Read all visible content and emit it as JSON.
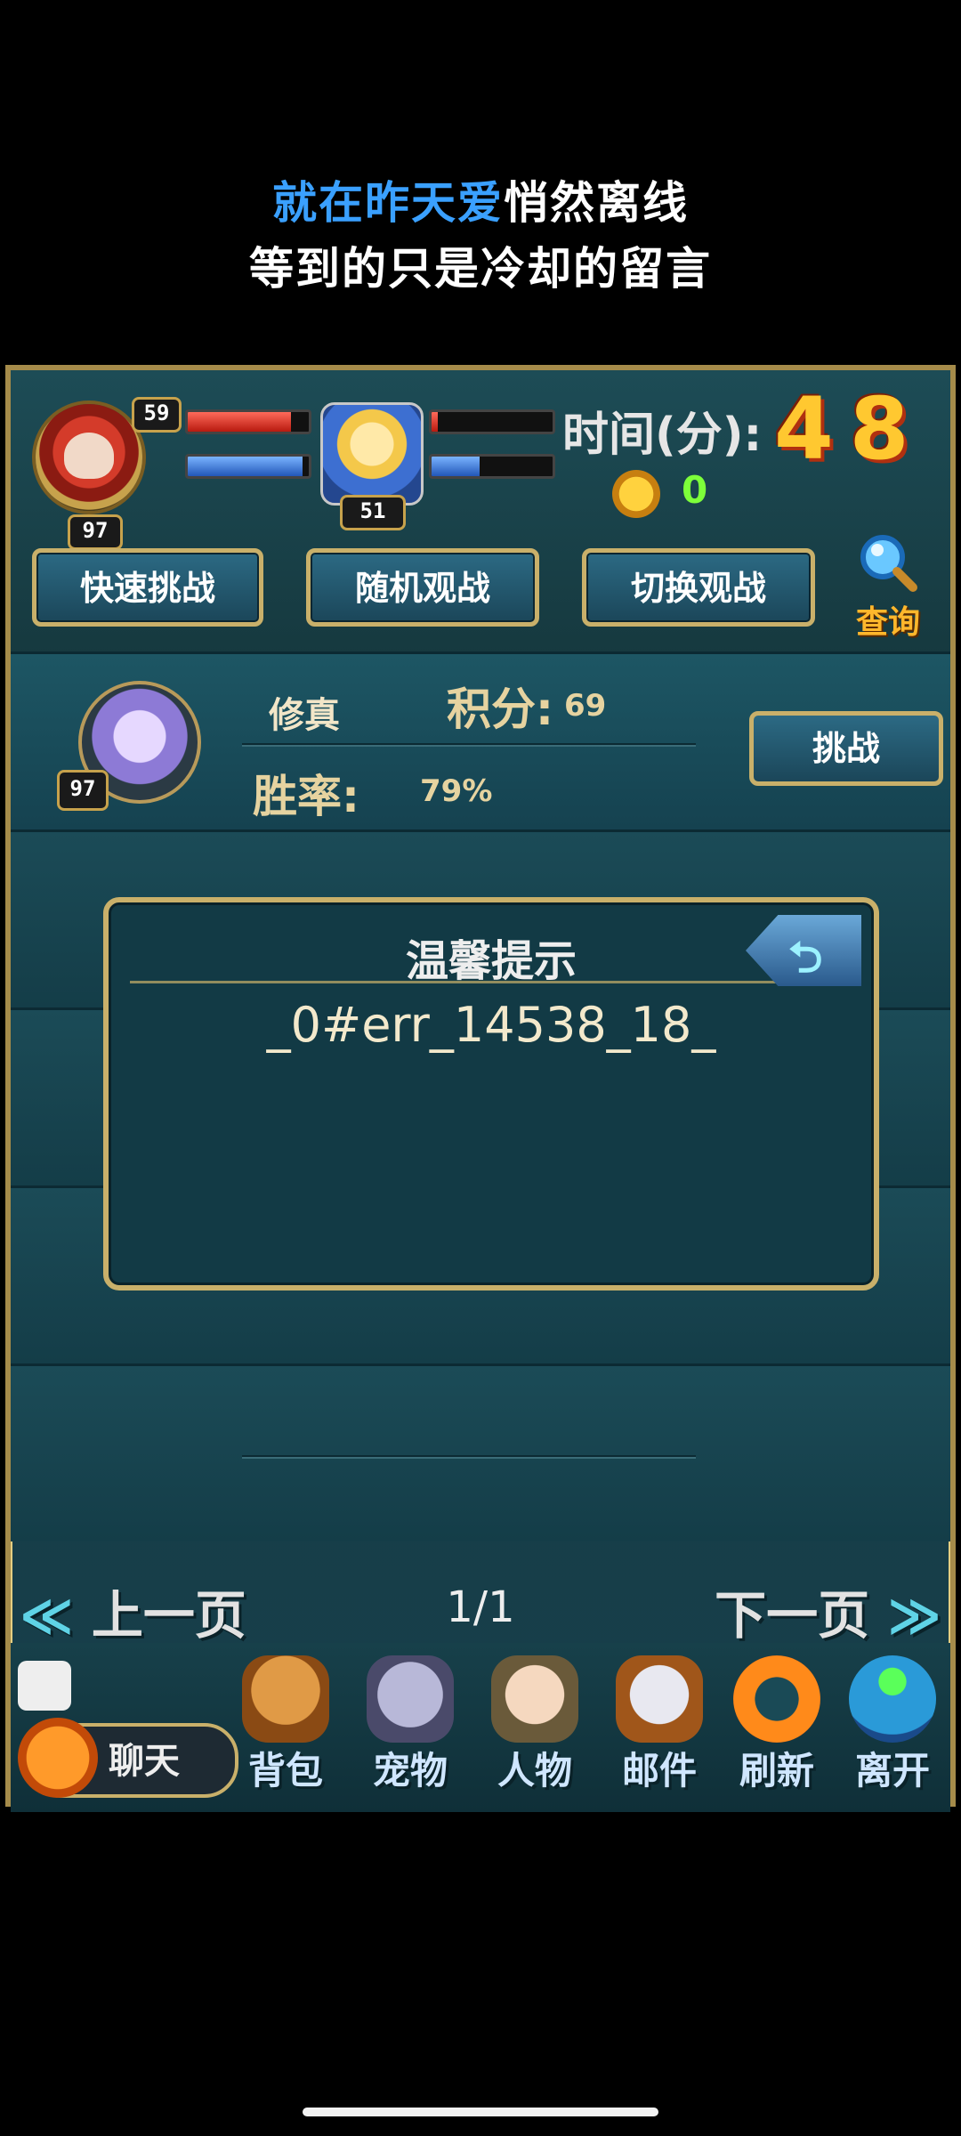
{
  "lyrics": {
    "line1_highlight": "就在昨天爱",
    "line1_rest": "悄然离线",
    "line2": "等到的只是冷却的留言"
  },
  "hud": {
    "player_level": "59",
    "player_rank": "97",
    "player_hp": 0.85,
    "player_mp": 0.95,
    "pet_level": "51",
    "pet_hp": 0.05,
    "pet_mp": 0.4,
    "time_label": "时间(分):",
    "time_value": "48",
    "coin_value": "0",
    "buttons": {
      "quick": "快速挑战",
      "random": "随机观战",
      "switch": "切换观战",
      "search": "查询"
    }
  },
  "opponent": {
    "level": "97",
    "name": "修真",
    "score_label": "积分:",
    "score_value": "69",
    "winrate_label": "胜率:",
    "winrate_value": "79%",
    "challenge_label": "挑战"
  },
  "dialog": {
    "title": "温馨提示",
    "message": "_0#err_14538_18_"
  },
  "pager": {
    "prev": "上一页",
    "page": "1/1",
    "next": "下一页"
  },
  "toolbar": {
    "chat": "聊天",
    "items": [
      {
        "label": "背包",
        "icon": "backpack-icon"
      },
      {
        "label": "宠物",
        "icon": "pet-icon"
      },
      {
        "label": "人物",
        "icon": "character-icon"
      },
      {
        "label": "邮件",
        "icon": "mail-icon"
      },
      {
        "label": "刷新",
        "icon": "refresh-icon"
      },
      {
        "label": "离开",
        "icon": "exit-icon"
      }
    ]
  }
}
